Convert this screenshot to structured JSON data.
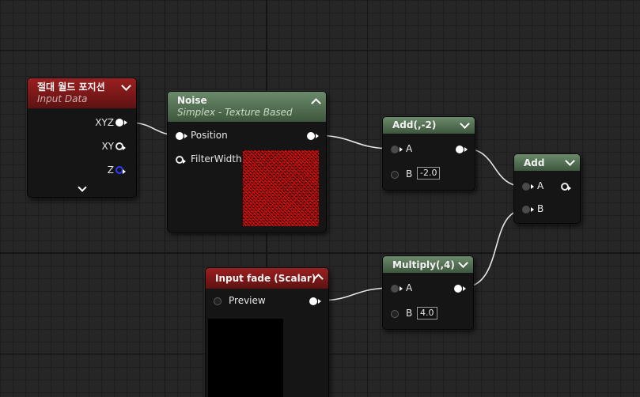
{
  "nodes": {
    "absolute_world_position": {
      "title": "절대 월드 포지션",
      "subtitle": "Input Data",
      "outputs": [
        "XYZ",
        "XY",
        "Z"
      ]
    },
    "noise": {
      "title": "Noise",
      "subtitle": "Simplex - Texture Based",
      "inputs": [
        "Position",
        "FilterWidth"
      ]
    },
    "add_minus2": {
      "title": "Add(,-2)",
      "input_a": "A",
      "input_b": "B",
      "b_value": "-2.0"
    },
    "multiply_4": {
      "title": "Multiply(,4)",
      "input_a": "A",
      "input_b": "B",
      "b_value": "4.0"
    },
    "add": {
      "title": "Add",
      "input_a": "A",
      "input_b": "B"
    },
    "input_fade": {
      "title": "Input fade (Scalar)",
      "preview_label": "Preview"
    }
  },
  "colors": {
    "header_red": "#9b1f1f",
    "header_green": "#6b8a6b",
    "noise_preview": "#e01010",
    "z_pin": "#2a3cff"
  }
}
